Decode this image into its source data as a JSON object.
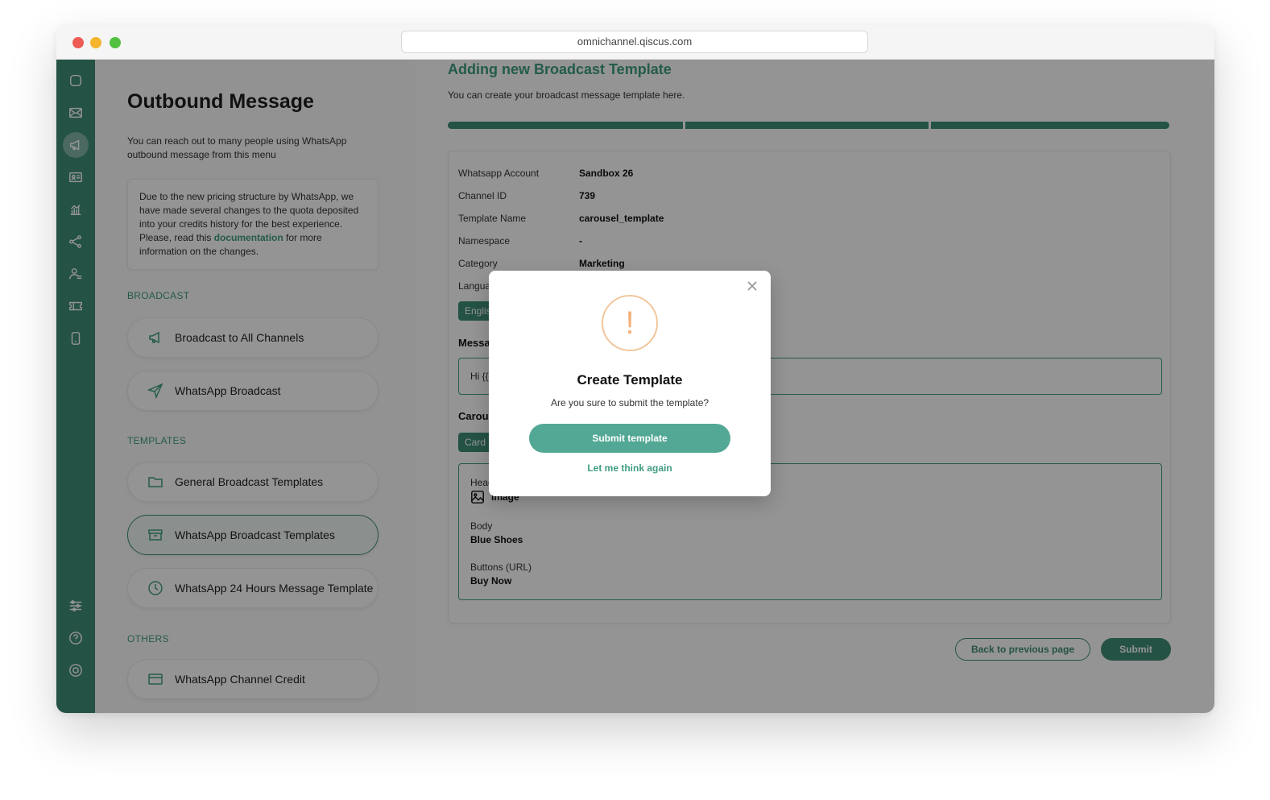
{
  "browser": {
    "url": "omnichannel.qiscus.com"
  },
  "sidebar_icons": [
    "chat-icon",
    "mail-icon",
    "megaphone-icon",
    "contact-card-icon",
    "analytics-icon",
    "share-nodes-icon",
    "agent-icon",
    "ticket-icon",
    "mobile-icon",
    "settings-sliders-icon",
    "help-icon",
    "power-icon"
  ],
  "left_panel": {
    "title": "Outbound Message",
    "description": "You can reach out to many people using WhatsApp outbound message from this menu",
    "notice": {
      "text_before": "Due to the new pricing structure by WhatsApp, we have made several changes to the quota deposited into your credits history for the best experience. Please, read this ",
      "link": "documentation",
      "text_after": " for more information on the changes."
    },
    "sections": {
      "broadcast": "BROADCAST",
      "templates": "TEMPLATES",
      "others": "OTHERS"
    },
    "items": {
      "broadcast_all": "Broadcast to All Channels",
      "whatsapp_broadcast": "WhatsApp Broadcast",
      "general_templates": "General Broadcast Templates",
      "whatsapp_templates": "WhatsApp Broadcast Templates",
      "whatsapp_24h": "WhatsApp 24 Hours Message Template",
      "channel_credit": "WhatsApp Channel Credit"
    }
  },
  "main": {
    "title": "Adding new Broadcast Template",
    "description": "You can create your broadcast message template here.",
    "details": [
      {
        "label": "Whatsapp Account",
        "value": "Sandbox 26"
      },
      {
        "label": "Channel ID",
        "value": "739"
      },
      {
        "label": "Template Name",
        "value": "carousel_template"
      },
      {
        "label": "Namespace",
        "value": "-"
      },
      {
        "label": "Category",
        "value": "Marketing"
      },
      {
        "label": "Languag",
        "value": ""
      }
    ],
    "language_pill": "Englisl",
    "message_heading": "Messa",
    "message_preview": "Hi {{1",
    "carousel_heading": "Carous",
    "card_pill": "Card 1",
    "carousel": {
      "header_label": "Head",
      "header_value": "Image",
      "body_label": "Body",
      "body_value": "Blue Shoes",
      "buttons_label": "Buttons (URL)",
      "buttons_value": "Buy Now"
    },
    "back_button": "Back to previous page",
    "submit_button": "Submit"
  },
  "modal": {
    "icon": "!",
    "title": "Create Template",
    "description": "Are you sure to submit the template?",
    "primary_button": "Submit template",
    "secondary_button": "Let me think again"
  }
}
